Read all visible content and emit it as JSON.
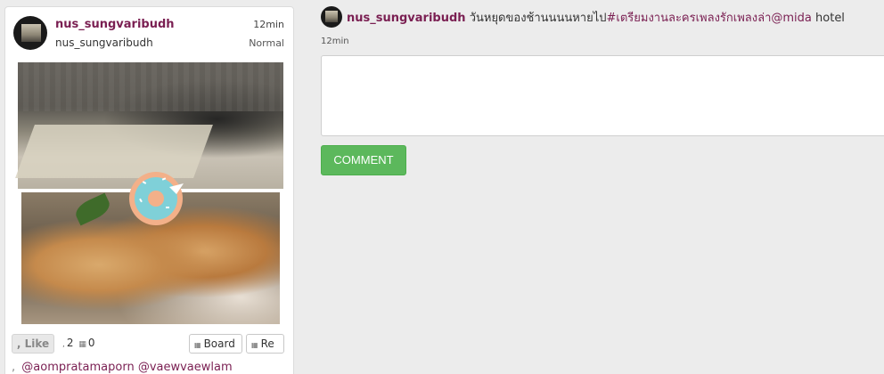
{
  "pin": {
    "username": "nus_sungvaribudh",
    "handle": "nus_sungvaribudh",
    "time": "12min",
    "privacy": "Normal",
    "like_label": "Like",
    "like_prefix": ",",
    "likes_count": "2",
    "repins_count": "0",
    "board_label": "Board",
    "repin_label": "Re",
    "mentions_lead": ",",
    "mentions": [
      "@aompratamaporn",
      "@vaewvaewlam"
    ],
    "icons": [
      "likes-icon",
      "repins-icon",
      "board-icon",
      "repin-icon"
    ]
  },
  "detail": {
    "username": "nus_sungvaribudh",
    "text_plain": "วันหยุดของช้านนนนหายไป",
    "hashtag": "#เตรียมงานละครเพลงรักเพลงล่า",
    "mention": "@mida",
    "trailing": " hotel",
    "time": "12min",
    "comment_placeholder": "",
    "comment_button": "COMMENT"
  },
  "colors": {
    "brand": "#7a1f52",
    "comment_button": "#5cb85c",
    "background": "#ececec"
  }
}
